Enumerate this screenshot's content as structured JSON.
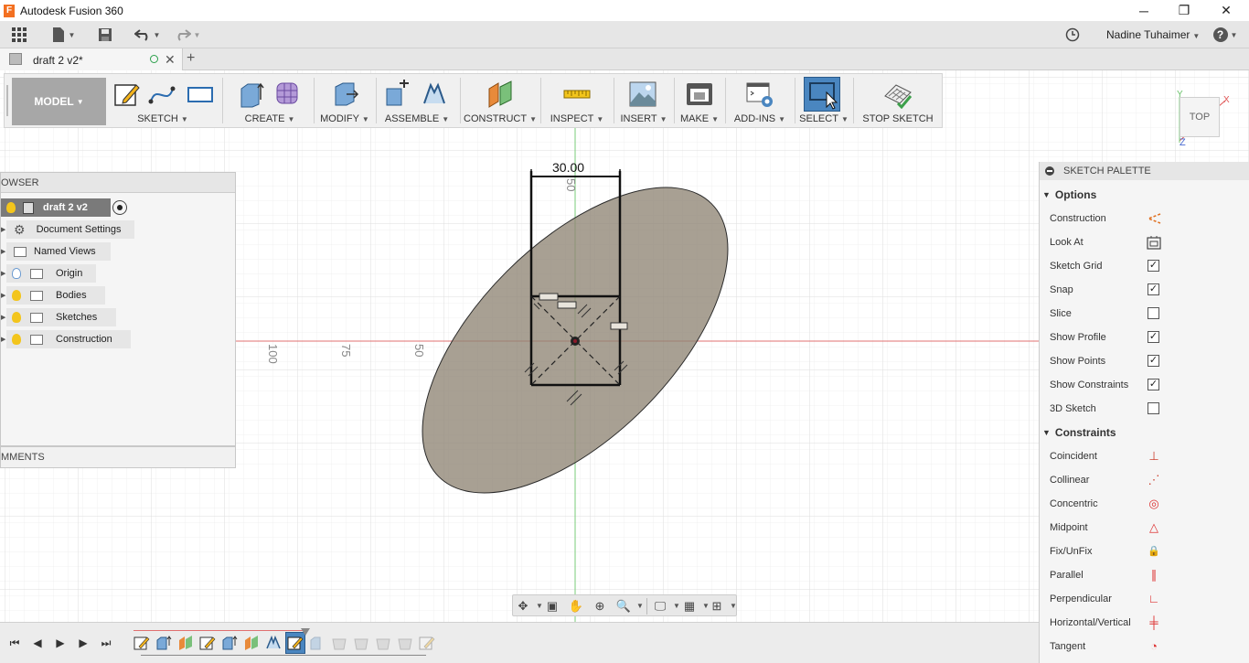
{
  "window": {
    "title": "Autodesk Fusion 360",
    "app_icon_letter": "F"
  },
  "window_controls": {
    "minimize": "─",
    "restore": "❐",
    "close": "✕"
  },
  "quick_access": {
    "user_name": "Nadine Tuhaimer",
    "help": "?"
  },
  "document_tab": {
    "label": "draft 2 v2*",
    "close": "✕",
    "new_tab": "+"
  },
  "toolbar": {
    "workspace": "MODEL",
    "groups": [
      {
        "label": "SKETCH"
      },
      {
        "label": "CREATE"
      },
      {
        "label": "MODIFY"
      },
      {
        "label": "ASSEMBLE"
      },
      {
        "label": "CONSTRUCT"
      },
      {
        "label": "INSPECT"
      },
      {
        "label": "INSERT"
      },
      {
        "label": "MAKE"
      },
      {
        "label": "ADD-INS"
      },
      {
        "label": "SELECT"
      },
      {
        "label": "STOP SKETCH"
      }
    ]
  },
  "viewcube": {
    "face": "TOP",
    "axis_x": "X",
    "axis_y": "Y",
    "axis_z": "Z"
  },
  "browser": {
    "header": "OWSER",
    "items": [
      {
        "label": "draft 2 v2"
      },
      {
        "label": "Document Settings"
      },
      {
        "label": "Named Views"
      },
      {
        "label": "Origin"
      },
      {
        "label": "Bodies"
      },
      {
        "label": "Sketches"
      },
      {
        "label": "Construction"
      }
    ]
  },
  "comments": {
    "label": "MMENTS"
  },
  "sketch": {
    "dimension": "30.00",
    "ruler_labels": [
      "100",
      "75",
      "50"
    ],
    "vertical_ruler_label": "50"
  },
  "palette": {
    "title": "SKETCH PALETTE",
    "options_title": "Options",
    "options": [
      {
        "label": "Construction",
        "icon": "construction-icon"
      },
      {
        "label": "Look At",
        "icon": "look-at-icon"
      },
      {
        "label": "Sketch Grid",
        "checked": true
      },
      {
        "label": "Snap",
        "checked": true
      },
      {
        "label": "Slice",
        "checked": false
      },
      {
        "label": "Show Profile",
        "checked": true
      },
      {
        "label": "Show Points",
        "checked": true
      },
      {
        "label": "Show Constraints",
        "checked": true
      },
      {
        "label": "3D Sketch",
        "checked": false
      }
    ],
    "constraints_title": "Constraints",
    "constraints": [
      {
        "label": "Coincident",
        "glyph": "⊥"
      },
      {
        "label": "Collinear",
        "glyph": "⋰"
      },
      {
        "label": "Concentric",
        "glyph": "◎"
      },
      {
        "label": "Midpoint",
        "glyph": "△"
      },
      {
        "label": "Fix/UnFix",
        "glyph": "🔒"
      },
      {
        "label": "Parallel",
        "glyph": "∥"
      },
      {
        "label": "Perpendicular",
        "glyph": "∟"
      },
      {
        "label": "Horizontal/Vertical",
        "glyph": "╪"
      },
      {
        "label": "Tangent",
        "glyph": "◔"
      }
    ]
  },
  "colors": {
    "profile_fill": "#8f8574",
    "select_active": "#4a86c0",
    "axis_red": "#e05555",
    "axis_green": "#44bb44",
    "accent_orange": "#f37021"
  }
}
